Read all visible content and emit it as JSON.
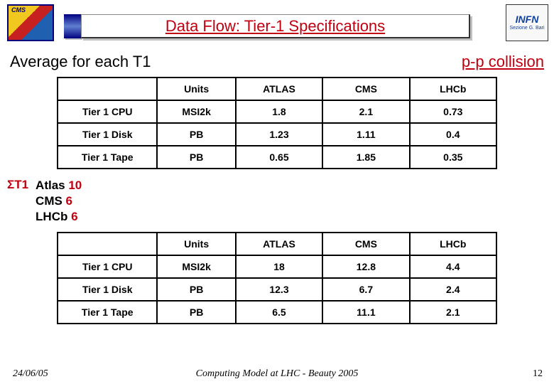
{
  "logos": {
    "cms": "CMS",
    "infn_line1": "INFN",
    "infn_line2": "Sezione G. Bari"
  },
  "title": "Data Flow: Tier-1 Specifications",
  "subheader": {
    "avg": "Average for each T1",
    "pp": "p-p collision"
  },
  "table1": {
    "headers": [
      "",
      "Units",
      "ATLAS",
      "CMS",
      "LHCb"
    ],
    "rows": [
      {
        "name": "Tier 1 CPU",
        "units": "MSI2k",
        "atlas": "1.8",
        "cms": "2.1",
        "lhcb": "0.73"
      },
      {
        "name": "Tier 1 Disk",
        "units": "PB",
        "atlas": "1.23",
        "cms": "1.11",
        "lhcb": "0.4"
      },
      {
        "name": "Tier 1 Tape",
        "units": "PB",
        "atlas": "0.65",
        "cms": "1.85",
        "lhcb": "0.35"
      }
    ]
  },
  "sigma": {
    "label": "ΣT1",
    "items": [
      {
        "exp": "Atlas",
        "num": "10"
      },
      {
        "exp": "CMS",
        "num": "6"
      },
      {
        "exp": "LHCb",
        "num": "6"
      }
    ]
  },
  "table2": {
    "headers": [
      "",
      "Units",
      "ATLAS",
      "CMS",
      "LHCb"
    ],
    "rows": [
      {
        "name": "Tier 1 CPU",
        "units": "MSI2k",
        "atlas": "18",
        "cms": "12.8",
        "lhcb": "4.4"
      },
      {
        "name": "Tier 1 Disk",
        "units": "PB",
        "atlas": "12.3",
        "cms": "6.7",
        "lhcb": "2.4"
      },
      {
        "name": "Tier 1 Tape",
        "units": "PB",
        "atlas": "6.5",
        "cms": "11.1",
        "lhcb": "2.1"
      }
    ]
  },
  "footer": {
    "date": "24/06/05",
    "center": "Computing Model at LHC - Beauty 2005",
    "page": "12"
  }
}
